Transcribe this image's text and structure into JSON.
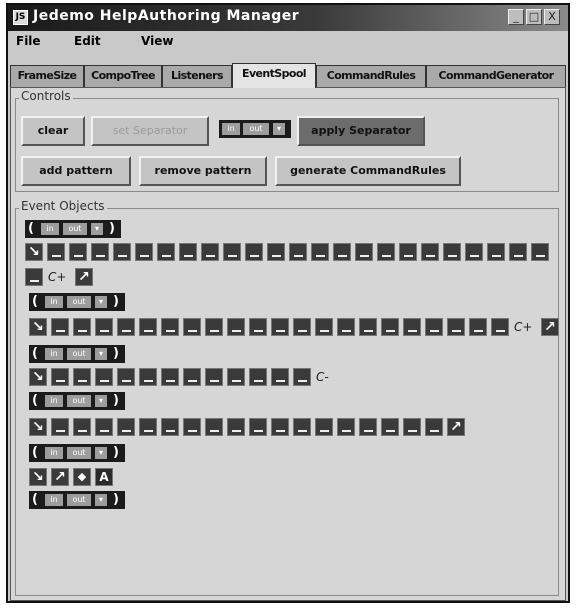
{
  "window": {
    "title": "Jedemo HelpAuthoring Manager",
    "icon_text": "JS",
    "controls": [
      "_",
      "□",
      "X"
    ]
  },
  "menu": [
    "File",
    "Edit",
    "View"
  ],
  "tabs": [
    {
      "label": "FrameSize",
      "active": false
    },
    {
      "label": "CompoTree",
      "active": false
    },
    {
      "label": "Listeners",
      "active": false
    },
    {
      "label": "EventSpool",
      "active": true
    },
    {
      "label": "CommandRules",
      "active": false
    },
    {
      "label": "CommandGenerator",
      "active": false
    }
  ],
  "controls": {
    "label": "Controls",
    "clear": "clear",
    "set_separator": "set Separator",
    "io": {
      "in": "in",
      "out": "out",
      "dropdown": "▾"
    },
    "apply_separator": "apply Separator",
    "add_pattern": "add pattern",
    "remove_pattern": "remove pattern",
    "generate_rules": "generate CommandRules"
  },
  "events": {
    "label": "Event Objects",
    "paren_open": "(",
    "paren_close": ")",
    "in": "in",
    "out": "out",
    "dropdown": "▾",
    "arrow_down_right": "↘",
    "arrow_up_right": "↗",
    "modifier_c_plus": "C+",
    "modifier_c_minus": "C-",
    "diamond": "◆",
    "letter_a": "A"
  }
}
